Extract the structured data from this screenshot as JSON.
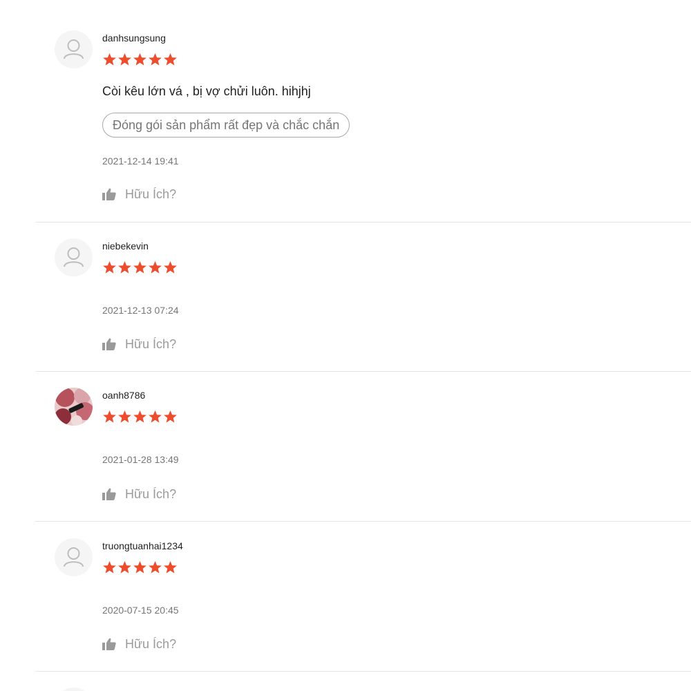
{
  "colors": {
    "star": "#ee4d2d",
    "muted_text": "#757575",
    "helpful_text": "#9a9a9a",
    "divider": "#e5e5e5"
  },
  "reviews": [
    {
      "username": "danhsungsung",
      "rating": 5,
      "avatar_icon": "user-icon",
      "comment": "Còi kêu lớn vá , bị vợ chửi luôn. hihjhj",
      "tag": "Đóng gói sản phẩm rất đẹp và chắc chắn",
      "timestamp": "2021-12-14 19:41",
      "helpful_label": "Hữu Ích?"
    },
    {
      "username": "niebekevin",
      "rating": 5,
      "avatar_icon": "user-icon",
      "timestamp": "2021-12-13 07:24",
      "helpful_label": "Hữu Ích?"
    },
    {
      "username": "oanh8786",
      "rating": 5,
      "avatar_icon": "lipstick-photo",
      "timestamp": "2021-01-28 13:49",
      "helpful_label": "Hữu Ích?"
    },
    {
      "username": "truongtuanhai1234",
      "rating": 5,
      "avatar_icon": "user-icon",
      "timestamp": "2020-07-15 20:45",
      "helpful_label": "Hữu Ích?"
    }
  ]
}
